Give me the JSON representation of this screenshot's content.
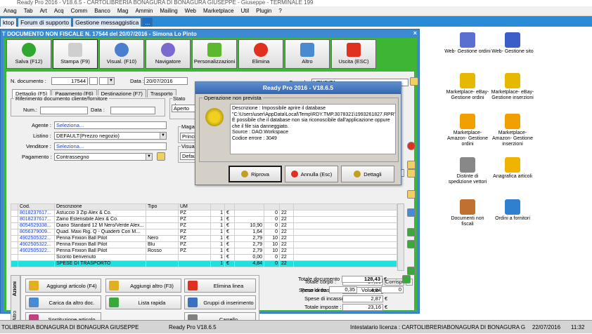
{
  "app": {
    "title": "Ready Pro 2016 - V18.6.5 - CARTOLIBRERIA BONAGURA DI BONAGURA GIUSEPPE - Giuseppe - TERMINALE 199"
  },
  "menu": [
    "Anag",
    "Tab",
    "Art",
    "Acq",
    "Comm",
    "Banco",
    "Mag",
    "Ammin",
    "Mailing",
    "Web",
    "Marketplace",
    "Util",
    "Plugin",
    "?"
  ],
  "desktop_tabs": [
    "ktop",
    "Forum di supporto",
    "Gestione messaggistica",
    "..."
  ],
  "desktop_icons": [
    {
      "label": "Web- Gestione ordini",
      "color": "#5a6fd0"
    },
    {
      "label": "Web- Gestione sito",
      "color": "#3b5dc9"
    },
    {
      "label": "Marketplace- eBay- Gestione ordini",
      "color": "#e6b800"
    },
    {
      "label": "Marketplace- eBay- Gestione inserzioni",
      "color": "#e6b800"
    },
    {
      "label": "Marketplace- Amazon- Gestione ordini",
      "color": "#f0a000"
    },
    {
      "label": "Marketplace- Amazon- Gestione inserzioni",
      "color": "#f0a000"
    },
    {
      "label": "Distinte di spedizione vettori",
      "color": "#888888"
    },
    {
      "label": "Anagrafica articoli",
      "color": "#f0b400"
    },
    {
      "label": "Documenti non fiscali",
      "color": "#c07030"
    },
    {
      "label": "Ordini a fornitori",
      "color": "#3080d0"
    }
  ],
  "window": {
    "title": "T DOCUMENTO NON FISCALE N. 17544 del 20/07/2016 - Simona Lo Pinto",
    "close": "×"
  },
  "toolbar": {
    "buttons": [
      {
        "label": "Salva (F12)",
        "color": "#2ea82e"
      },
      {
        "label": "Stampa (F9)",
        "color": "#cfcfcf"
      },
      {
        "label": "Visual. (F10)",
        "color": "#4a7fd0"
      },
      {
        "label": "Navigatore",
        "color": "#7a6ad0"
      },
      {
        "label": "Personalizzazioni",
        "color": "#5cb82e"
      },
      {
        "label": "Elimina",
        "color": "#e03020"
      },
      {
        "label": "Altro",
        "color": "#4a8ad0"
      },
      {
        "label": "Uscita (ESC)",
        "color": "#e03020"
      }
    ]
  },
  "form": {
    "ndoc_label": "N. documento :",
    "ndoc_value": "17544",
    "data_label": "Data :",
    "data_value": "20/07/2016",
    "causale_label": "Causale :",
    "causale_value": "VENDITA",
    "tabs": [
      "Dettaglio (F5)",
      "Pagamento (F6)",
      "Destinazione (F7)",
      "Trasporto"
    ],
    "rif_label": "Riferimento documento cliente/fornitore",
    "num_label": "Num.:",
    "data2_label": "Data :",
    "agente_label": "Agente :",
    "agente_value": "Seleziona...",
    "listino_label": "Listino :",
    "listino_value": "DEFAULT(Prezzo negozio)",
    "venditore_label": "Venditore :",
    "venditore_value": "Seleziona...",
    "pagamento_label": "Pagamento :",
    "pagamento_value": "Contrassegno",
    "stato_label": "Stato docu",
    "stato_value": "Aperto",
    "magaz_label": "Magazz",
    "magaz_value": "Principal",
    "visual_label": "Visualiz",
    "visual_value": "Default"
  },
  "grid": {
    "headers": [
      "Cod.",
      "Descrizione",
      "Tipo",
      "UM",
      "",
      "",
      "",
      "",
      ""
    ],
    "rows": [
      [
        "8018237617...",
        "Astuccio 3 Zip Alex & Co.",
        "",
        "PZ",
        "1",
        "€",
        "",
        "0",
        "22"
      ],
      [
        "8018237617...",
        "Zaino Estensibile Alex & Co.",
        "",
        "PZ",
        "1",
        "€",
        "",
        "0",
        "22"
      ],
      [
        "8054529338...",
        "Diario Standard 12 M Nero/Verde Alex...",
        "",
        "PZ",
        "1",
        "€",
        "10,90",
        "0",
        "22"
      ],
      [
        "8056379009...",
        "Quad. Maxi Rig. Q - Quaderti Con M...",
        "",
        "PZ",
        "1",
        "€",
        "1,64",
        "0",
        "22"
      ],
      [
        "4902505322...",
        "Penna Frixion Ball Pilot",
        "Nero",
        "PZ",
        "1",
        "€",
        "2,79",
        "10",
        "22"
      ],
      [
        "4902505322...",
        "Penna Frixion Ball Pilot",
        "Blu",
        "PZ",
        "1",
        "€",
        "2,79",
        "10",
        "22"
      ],
      [
        "4902505322...",
        "Penna Frixion Ball Pilot",
        "Rosso",
        "PZ",
        "1",
        "€",
        "2,79",
        "10",
        "22"
      ],
      [
        "",
        "Sconto benvenuto",
        "",
        "",
        "1",
        "€",
        "0,00",
        "0",
        "22"
      ],
      [
        "",
        "SPESE DI TRASPORTO",
        "",
        "",
        "1",
        "€",
        "4,84",
        "0",
        "22"
      ]
    ]
  },
  "actions": {
    "side_tabs": [
      "Azioni",
      "Altro"
    ],
    "buttons": [
      {
        "label": "Aggiungi articolo (F4)",
        "color": "#e0b020"
      },
      {
        "label": "Aggiungi altro (F3)",
        "color": "#e0b020"
      },
      {
        "label": "Elimina linea",
        "color": "#e03020"
      },
      {
        "label": "Carica da altro doc.",
        "color": "#4a8ad0"
      },
      {
        "label": "Lista rapida",
        "color": "#3aa83a"
      },
      {
        "label": "Gruppi di inserimento",
        "color": "#3a70c0"
      },
      {
        "label": "Sostituzione articolo",
        "color": "#c04080"
      },
      {
        "label": "Carrello",
        "color": "#808080"
      }
    ]
  },
  "totals": {
    "corpo_label": "Totale corpo :",
    "corpo_value": "97,56",
    "corrisp": "Corrisp.",
    "q": "?",
    "trasporto_label": "Spese di trasporto :",
    "trasporto_value": "4,84",
    "incasso_label": "Spese di incasso :",
    "incasso_value": "2,87",
    "imposte_label": "Totale imposte :",
    "imposte_value": "23,16",
    "documento_label": "Totale documento :",
    "documento_value": "128,43",
    "euro": "€",
    "peso_label": "Peso lordo :",
    "peso_value": "0,35",
    "volume_label": "Volume :",
    "volume_value": "0"
  },
  "dialog": {
    "title": "Ready Pro 2016 - V18.6.5",
    "group_title": "Operazione non prevista",
    "message": "Descrizione : Impossibile aprire il database \"C:\\Users\\user\\AppData\\Local\\Temp\\RDY.TMP.3078321\\1993261827.RPR\". È possibile che il database non sia riconoscibile dall'applicazione oppure che il file sia danneggiato.\nSource : DAO.Workspace\nCodice errore : 3049",
    "buttons": [
      "Riprova",
      "Annulla (Esc)",
      "Dettagli"
    ]
  },
  "status": {
    "left": "TOLIBRERIA BONAGURA DI BONAGURA GIUSEPPE",
    "version": "Ready Pro V18.6.5",
    "license": "Intestatario licenza : CARTOLIBRERIABONAGURA DI BONAGURA G",
    "date": "22/07/2016",
    "time": "11:32"
  }
}
